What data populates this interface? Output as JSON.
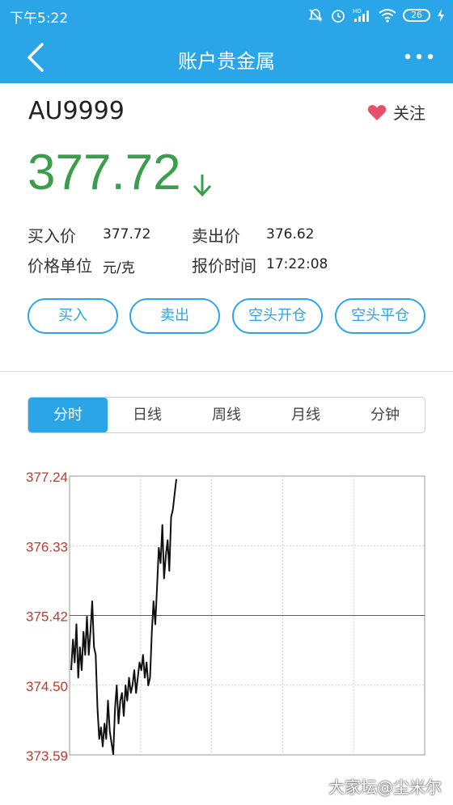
{
  "status_bar": {
    "time": "下午5:22",
    "battery": "26",
    "icons": [
      "mute-icon",
      "alarm-icon",
      "hd-signal-icon",
      "wifi-icon",
      "battery-icon",
      "charging-icon"
    ]
  },
  "nav": {
    "title": "账户贵金属",
    "back_icon": "chevron-left-icon",
    "more_icon": "more-icon"
  },
  "quote": {
    "symbol": "AU9999",
    "follow_label": "关注",
    "price": "377.72",
    "direction": "down",
    "buy_price_label": "买入价",
    "buy_price": "377.72",
    "sell_price_label": "卖出价",
    "sell_price": "376.62",
    "unit_label": "价格单位",
    "unit": "元/克",
    "time_label": "报价时间",
    "time": "17:22:08"
  },
  "actions": [
    "买入",
    "卖出",
    "空头开仓",
    "空头平仓"
  ],
  "tabs": [
    {
      "label": "分时",
      "active": true
    },
    {
      "label": "日线",
      "active": false
    },
    {
      "label": "周线",
      "active": false
    },
    {
      "label": "月线",
      "active": false
    },
    {
      "label": "分钟",
      "active": false
    }
  ],
  "colors": {
    "accent": "#2aa6e8",
    "price_down": "#3a9e4c",
    "axis_label": "#c0392b",
    "heart": "#e8506a"
  },
  "chart_data": {
    "type": "line",
    "y_ticks": [
      "377.24",
      "376.33",
      "375.42",
      "374.50",
      "373.59"
    ],
    "ylim": [
      373.59,
      377.24
    ],
    "reference_line": 375.42,
    "series": [
      {
        "values": [
          374.7,
          375.1,
          374.8,
          375.3,
          374.6,
          375.0,
          374.7,
          375.2,
          374.9,
          375.4,
          374.9,
          375.2,
          375.6,
          375.0,
          374.9,
          374.2,
          373.8,
          373.95,
          373.7,
          374.0,
          373.8,
          374.3,
          373.9,
          373.75,
          373.6,
          374.2,
          374.5,
          374.0,
          374.3,
          374.4,
          374.1,
          374.5,
          374.3,
          374.6,
          374.4,
          374.5,
          374.7,
          374.4,
          374.6,
          374.8,
          374.7,
          374.9,
          374.6,
          374.8,
          374.5,
          374.6,
          375.2,
          375.6,
          375.3,
          375.8,
          376.3,
          376.1,
          376.6,
          375.9,
          376.2,
          376.4,
          376.0,
          376.7,
          376.8,
          377.0,
          377.2
        ]
      }
    ],
    "grid": true
  },
  "watermark": "大家坛@尘米尔"
}
